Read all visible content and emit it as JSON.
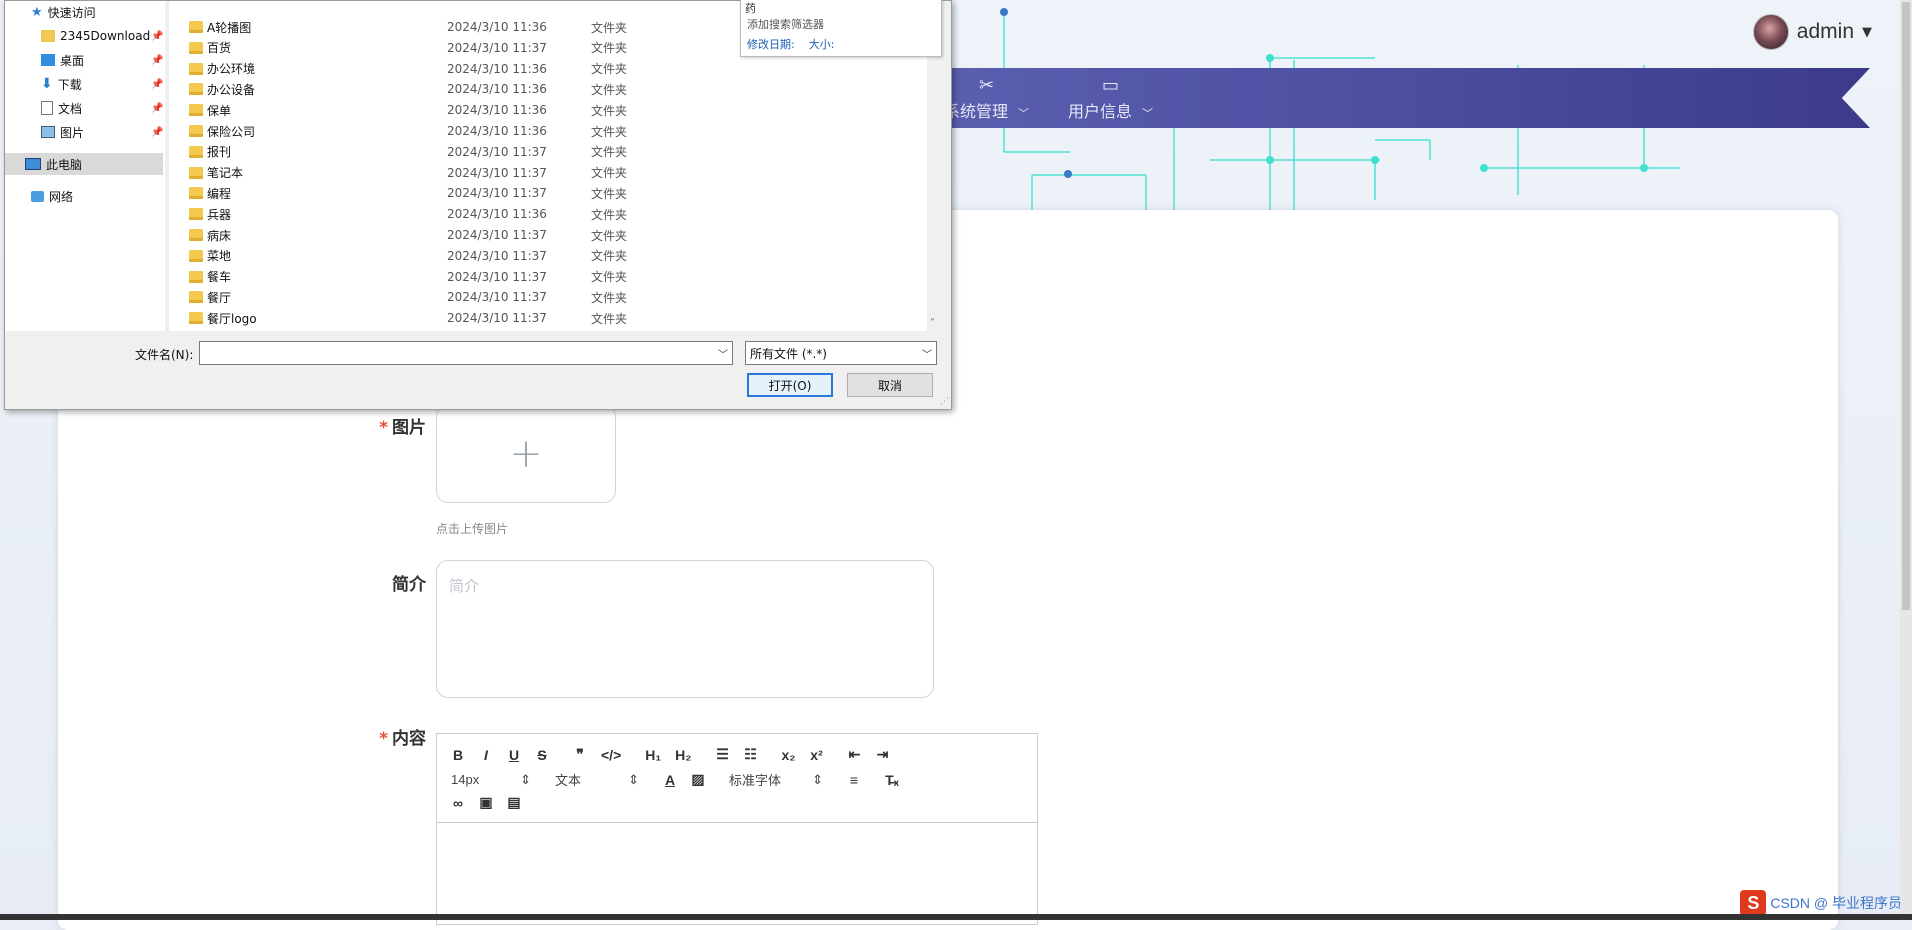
{
  "app": {
    "username": "admin",
    "nav": [
      {
        "label": "系统管理",
        "icon": "settings-icon"
      },
      {
        "label": "用户信息",
        "icon": "user-card-icon"
      }
    ],
    "form": {
      "image_label": "图片",
      "upload_tip": "点击上传图片",
      "intro_label": "简介",
      "intro_placeholder": "简介",
      "content_label": "内容",
      "font_size": "14px",
      "text_style": "文本",
      "font_family": "标准字体"
    }
  },
  "watermark": "CSDN @ 毕业程序员",
  "dialog": {
    "nav_items": [
      {
        "label": "快速访问",
        "icon": "star-icon"
      },
      {
        "label": "2345Download",
        "icon": "folder-icon"
      },
      {
        "label": "桌面",
        "icon": "desktop-icon"
      },
      {
        "label": "下载",
        "icon": "download-icon"
      },
      {
        "label": "文档",
        "icon": "document-icon"
      },
      {
        "label": "图片",
        "icon": "pictures-icon"
      },
      {
        "label": "此电脑",
        "icon": "computer-icon"
      },
      {
        "label": "网络",
        "icon": "network-icon"
      }
    ],
    "search_popup": {
      "query": "药",
      "hint": "添加搜索筛选器",
      "filter_date": "修改日期:",
      "filter_size": "大小:"
    },
    "files": [
      {
        "name": "A轮播图",
        "date": "2024/3/10 11:36",
        "type": "文件夹"
      },
      {
        "name": "百货",
        "date": "2024/3/10 11:37",
        "type": "文件夹"
      },
      {
        "name": "办公环境",
        "date": "2024/3/10 11:36",
        "type": "文件夹"
      },
      {
        "name": "办公设备",
        "date": "2024/3/10 11:36",
        "type": "文件夹"
      },
      {
        "name": "保单",
        "date": "2024/3/10 11:36",
        "type": "文件夹"
      },
      {
        "name": "保险公司",
        "date": "2024/3/10 11:36",
        "type": "文件夹"
      },
      {
        "name": "报刊",
        "date": "2024/3/10 11:37",
        "type": "文件夹"
      },
      {
        "name": "笔记本",
        "date": "2024/3/10 11:37",
        "type": "文件夹"
      },
      {
        "name": "编程",
        "date": "2024/3/10 11:37",
        "type": "文件夹"
      },
      {
        "name": "兵器",
        "date": "2024/3/10 11:36",
        "type": "文件夹"
      },
      {
        "name": "病床",
        "date": "2024/3/10 11:37",
        "type": "文件夹"
      },
      {
        "name": "菜地",
        "date": "2024/3/10 11:37",
        "type": "文件夹"
      },
      {
        "name": "餐车",
        "date": "2024/3/10 11:37",
        "type": "文件夹"
      },
      {
        "name": "餐厅",
        "date": "2024/3/10 11:37",
        "type": "文件夹"
      },
      {
        "name": "餐厅logo",
        "date": "2024/3/10 11:37",
        "type": "文件夹"
      }
    ],
    "filename_label": "文件名(N):",
    "filename_value": "",
    "filetype": "所有文件 (*.*)",
    "open_label": "打开(O)",
    "cancel_label": "取消"
  }
}
